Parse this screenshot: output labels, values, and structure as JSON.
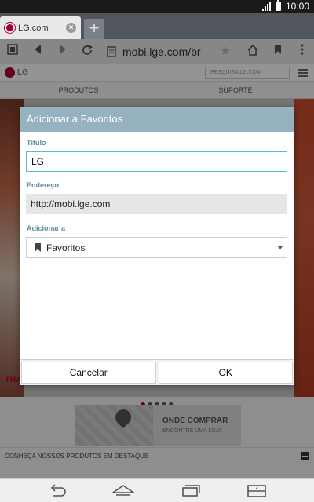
{
  "status_bar": {
    "time": "10:00"
  },
  "tab": {
    "title": "LG.com",
    "new_tab": "+"
  },
  "toolbar": {
    "url": "mobi.lge.com/br"
  },
  "webpage": {
    "search_placeholder": "PESQUISA LG.COM",
    "nav": [
      "PRODUTOS",
      "SUPORTE"
    ],
    "hero_text": "TRA",
    "onde_title": "ONDE COMPRAR",
    "onde_sub": "ENCONTRE UMA LOJA",
    "conheca": "CONHEÇA NOSSOS PRODUTOS EM DESTAQUE"
  },
  "dialog": {
    "title": "Adicionar a Favoritos",
    "title_label": "Título",
    "title_value": "LG",
    "address_label": "Endereço",
    "address_value": "http://mobi.lge.com",
    "add_to_label": "Adicionar a",
    "add_to_value": "Favoritos",
    "cancel": "Cancelar",
    "ok": "OK"
  },
  "colors": {
    "dialog_header": "#96b2c1",
    "label_blue": "#5d8aa3",
    "input_focus": "#4fc1c9",
    "lg_red": "#a50034"
  }
}
